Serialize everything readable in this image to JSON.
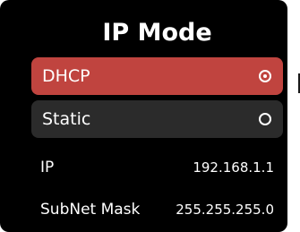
{
  "header": {
    "title": "IP Mode"
  },
  "options": [
    {
      "label": "DHCP",
      "selected": true
    },
    {
      "label": "Static",
      "selected": false
    }
  ],
  "info": [
    {
      "key": "IP",
      "value": "192.168.1.1"
    },
    {
      "key": "SubNet Mask",
      "value": "255.255.255.0"
    }
  ],
  "colors": {
    "background": "#000000",
    "selected": "#c0443f",
    "unselected": "#2b2b2b",
    "text": "#ffffff"
  },
  "icons": {
    "selected": "radio-checked-icon",
    "unselected": "radio-unchecked-icon"
  }
}
